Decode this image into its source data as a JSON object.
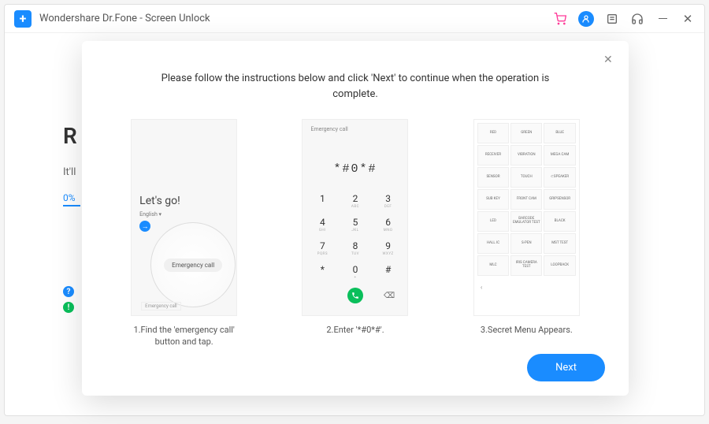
{
  "titlebar": {
    "app_name": "Wondershare Dr.Fone - Screen Unlock"
  },
  "background": {
    "heading_visible": "R",
    "subtext_visible": "It'll",
    "progress": "0%"
  },
  "modal": {
    "instruction": "Please follow the instructions below and click 'Next' to continue when the operation is complete.",
    "step1": {
      "caption": "1.Find the 'emergency call' button and tap.",
      "lets_go": "Let's go!",
      "language": "English ▾",
      "emergency_button": "Emergency call",
      "bottom_tag": "Emergency call"
    },
    "step2": {
      "caption": "2.Enter '*#0*#'.",
      "header": "Emergency call",
      "code": "*#0*#",
      "keys": [
        {
          "n": "1",
          "s": ""
        },
        {
          "n": "2",
          "s": "ABC"
        },
        {
          "n": "3",
          "s": "DEF"
        },
        {
          "n": "4",
          "s": "GHI"
        },
        {
          "n": "5",
          "s": "JKL"
        },
        {
          "n": "6",
          "s": "MNO"
        },
        {
          "n": "7",
          "s": "PQRS"
        },
        {
          "n": "8",
          "s": "TUV"
        },
        {
          "n": "9",
          "s": "WXYZ"
        },
        {
          "n": "*",
          "s": ""
        },
        {
          "n": "0",
          "s": "+"
        },
        {
          "n": "#",
          "s": ""
        }
      ]
    },
    "step3": {
      "caption": "3.Secret Menu Appears.",
      "cells": [
        "RED",
        "GREEN",
        "BLUE",
        "RECEIVER",
        "VIBRATION",
        "MEGA CAM",
        "SENSOR",
        "TOUCH",
        "⊂SPEAKER",
        "SUB KEY",
        "FRONT CAM",
        "GRIPSENSOR",
        "LED",
        "BARCODE EMULATOR TEST",
        "BLACK",
        "HALL IC",
        "S-PEN",
        "MST TEST",
        "MLC",
        "IRIS CAMERA TEST",
        "LOOPBACK"
      ]
    },
    "next_button": "Next"
  }
}
